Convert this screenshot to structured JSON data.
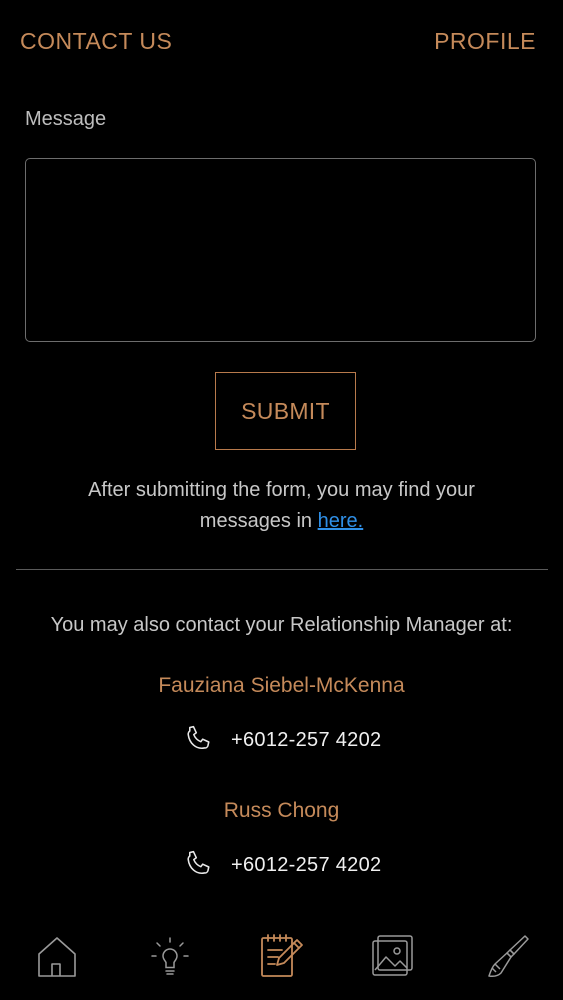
{
  "header": {
    "left_tab": "CONTACT US",
    "right_tab": "PROFILE"
  },
  "form": {
    "message_label": "Message",
    "message_value": "",
    "submit_label": "SUBMIT"
  },
  "note": {
    "text": "After submitting the form, you may find your messages in ",
    "link_text": "here."
  },
  "contact": {
    "intro": "You may also contact your Relationship Manager at:",
    "managers": [
      {
        "name": "Fauziana Siebel-McKenna",
        "phone": "+6012-257 4202"
      },
      {
        "name": "Russ Chong",
        "phone": "+6012-257 4202"
      }
    ]
  },
  "bottom_nav": {
    "items": [
      {
        "icon": "home-icon",
        "active": false
      },
      {
        "icon": "lightbulb-icon",
        "active": false
      },
      {
        "icon": "notepad-pencil-icon",
        "active": true
      },
      {
        "icon": "gallery-icon",
        "active": false
      },
      {
        "icon": "paintbrush-icon",
        "active": false
      }
    ]
  },
  "colors": {
    "background": "#000000",
    "accent": "#c58a5a",
    "text": "#c8c8c8",
    "link": "#2f8fe6",
    "icon_inactive": "#9a9a9a"
  }
}
